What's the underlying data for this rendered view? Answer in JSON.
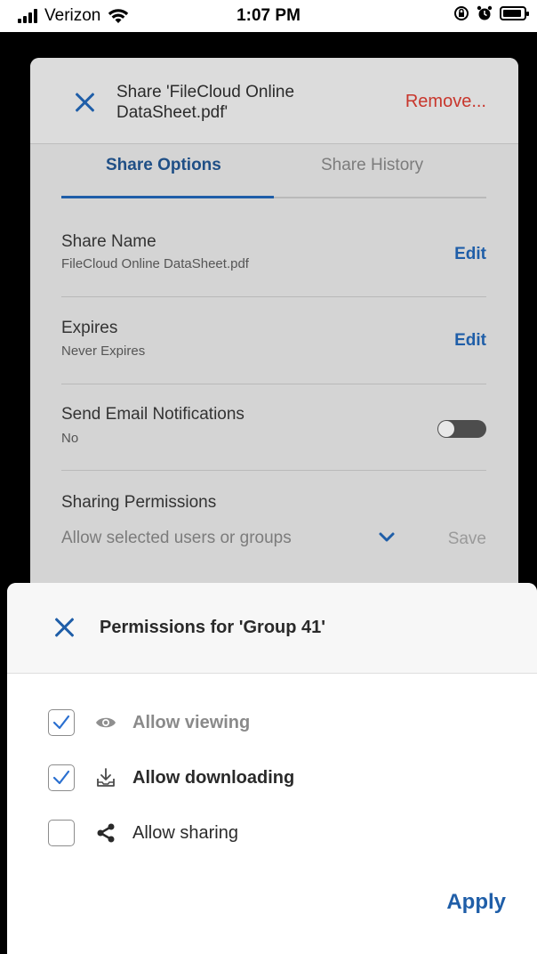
{
  "status_bar": {
    "carrier": "Verizon",
    "time": "1:07 PM",
    "battery_level": 0.9
  },
  "share_dialog": {
    "title": "Share 'FileCloud Online DataSheet.pdf'",
    "remove_label": "Remove...",
    "tabs": [
      {
        "label": "Share Options",
        "active": true
      },
      {
        "label": "Share History",
        "active": false
      }
    ],
    "share_name": {
      "label": "Share Name",
      "value": "FileCloud Online DataSheet.pdf",
      "action": "Edit"
    },
    "expires": {
      "label": "Expires",
      "value": "Never Expires",
      "action": "Edit"
    },
    "email_notifications": {
      "label": "Send Email Notifications",
      "value": "No",
      "enabled": false
    },
    "sharing_permissions": {
      "label": "Sharing Permissions",
      "value": "Allow selected users or groups",
      "save_label": "Save"
    }
  },
  "permissions_sheet": {
    "title": "Permissions for 'Group 41'",
    "options": [
      {
        "label": "Allow viewing",
        "checked": true,
        "icon": "eye-icon",
        "muted": true
      },
      {
        "label": "Allow downloading",
        "checked": true,
        "icon": "download-icon",
        "muted": false
      },
      {
        "label": "Allow sharing",
        "checked": false,
        "icon": "share-icon",
        "muted": false
      }
    ],
    "apply_label": "Apply"
  },
  "colors": {
    "accent": "#1f5ea8",
    "danger": "#c8362c",
    "checkbox_accent": "#2a6fd0"
  }
}
